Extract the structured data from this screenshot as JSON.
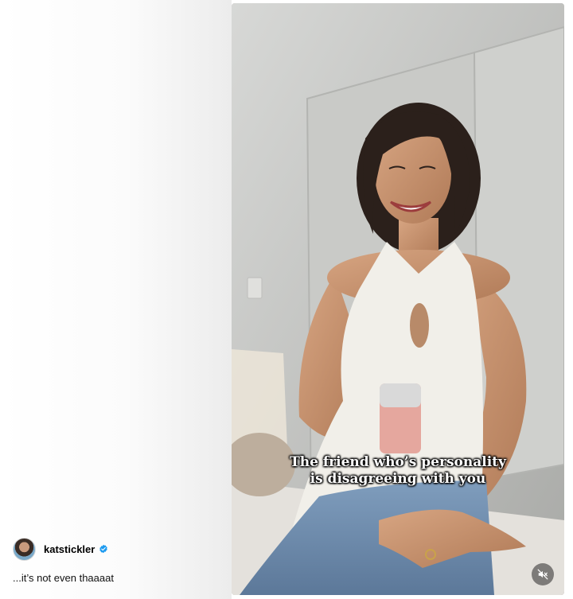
{
  "post": {
    "username": "katstickler",
    "verified": true,
    "caption": "...it’s not even thaaaat"
  },
  "video": {
    "subtitle_line1": "The friend who’s personality",
    "subtitle_line2": "is disagreeing with you",
    "muted": true
  },
  "icons": {
    "verified": "verified-badge-icon",
    "mute": "speaker-muted-icon"
  },
  "colors": {
    "verified_badge": "#1d9bf0",
    "background": "#ffffff"
  }
}
